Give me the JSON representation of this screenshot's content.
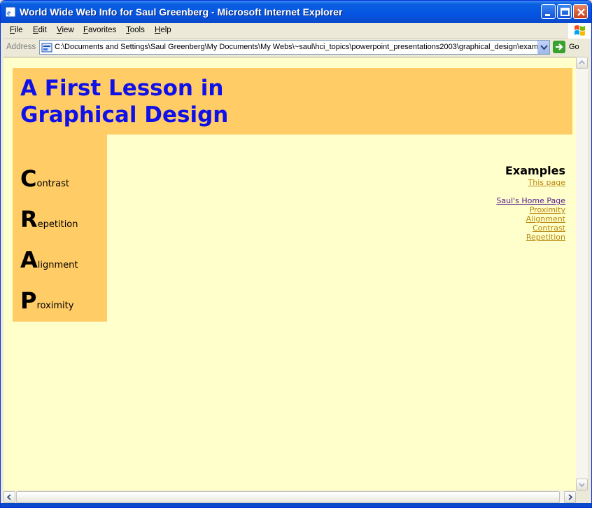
{
  "window": {
    "title": "World Wide Web Info for Saul Greenberg - Microsoft Internet Explorer"
  },
  "menu": [
    "File",
    "Edit",
    "View",
    "Favorites",
    "Tools",
    "Help"
  ],
  "address": {
    "label": "Address",
    "url": "C:\\Documents and Settings\\Saul Greenberg\\My Documents\\My Webs\\~saul\\hci_topics\\powerpoint_presentations2003\\graphical_design\\exampl",
    "go_label": "Go"
  },
  "page": {
    "title_line1": "A First Lesson in",
    "title_line2": "Graphical Design",
    "crap": [
      {
        "letter": "C",
        "rest": "ontrast"
      },
      {
        "letter": "R",
        "rest": "epetition"
      },
      {
        "letter": "A",
        "rest": "lignment"
      },
      {
        "letter": "P",
        "rest": "roximity"
      }
    ],
    "examples_heading": "Examples",
    "this_page": "This page",
    "links": [
      "Saul's Home Page",
      "Proximity",
      "Alignment",
      "Contrast",
      "Repetition"
    ]
  },
  "colors": {
    "page_bg": "#ffffcc",
    "banner_bg": "#ffcc66",
    "title": "#1010e8",
    "link": "#b8860b",
    "visited": "#551a8b"
  }
}
